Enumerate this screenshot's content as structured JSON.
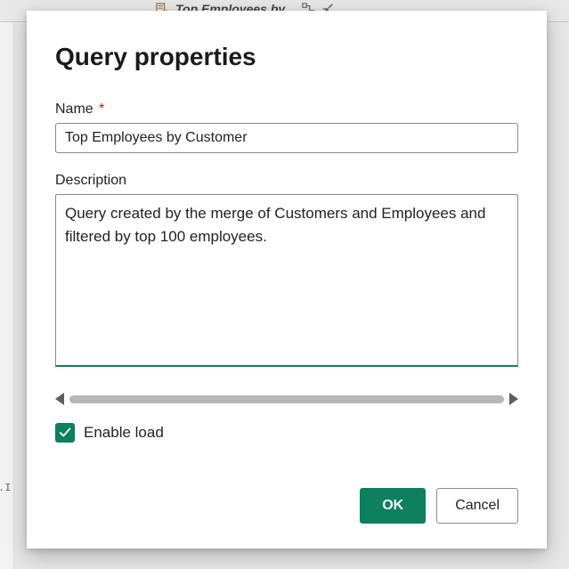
{
  "background": {
    "tab_title": "Top Employees by...",
    "sidebar_fragment": ".I"
  },
  "dialog": {
    "title": "Query properties",
    "name": {
      "label": "Name",
      "required_marker": "*",
      "value": "Top Employees by Customer"
    },
    "description": {
      "label": "Description",
      "value": "Query created by the merge of Customers and Employees and filtered by top 100 employees."
    },
    "enable_load": {
      "checked": true,
      "label": "Enable load"
    },
    "buttons": {
      "ok": "OK",
      "cancel": "Cancel"
    }
  },
  "colors": {
    "accent": "#0d805e",
    "required": "#a4262c"
  }
}
